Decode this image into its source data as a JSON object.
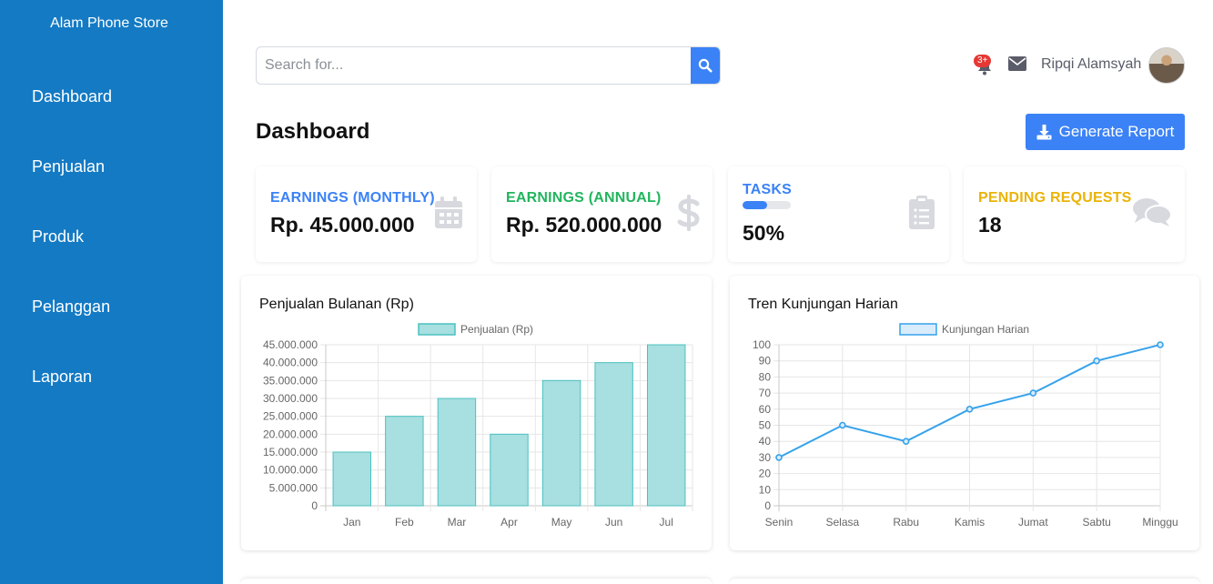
{
  "app": {
    "brand": "Alam Phone Store"
  },
  "sidebar": {
    "items": [
      {
        "label": "Dashboard"
      },
      {
        "label": "Penjualan"
      },
      {
        "label": "Produk"
      },
      {
        "label": "Pelanggan"
      },
      {
        "label": "Laporan"
      }
    ]
  },
  "topbar": {
    "search_placeholder": "Search for...",
    "search_icon": "search-icon",
    "alerts_badge": "3+",
    "user_name": "Ripqi Alamsyah"
  },
  "page": {
    "title": "Dashboard",
    "report_button": "Generate Report"
  },
  "cards": [
    {
      "label": "EARNINGS (MONTHLY)",
      "value": "Rp. 45.000.000",
      "color": "#3b82f6",
      "icon": "calendar-icon"
    },
    {
      "label": "EARNINGS (ANNUAL)",
      "value": "Rp. 520.000.000",
      "color": "#22b55e",
      "icon": "dollar-icon"
    },
    {
      "label": "TASKS",
      "value": "50%",
      "progress": 0.5,
      "color": "#3b82f6",
      "icon": "clipboard-icon"
    },
    {
      "label": "PENDING REQUESTS",
      "value": "18",
      "color": "#eab308",
      "icon": "comments-icon"
    }
  ],
  "colors": {
    "sidebar": "#147ac4",
    "primary": "#3b82f6",
    "bar_fill": "#a8dfe0",
    "bar_stroke": "#4bc0c0",
    "line": "#36a2eb"
  },
  "chart_data": [
    {
      "type": "bar",
      "title": "Penjualan Bulanan (Rp)",
      "categories": [
        "Jan",
        "Feb",
        "Mar",
        "Apr",
        "May",
        "Jun",
        "Jul"
      ],
      "series": [
        {
          "name": "Penjualan (Rp)",
          "values": [
            15000000,
            25000000,
            30000000,
            20000000,
            35000000,
            40000000,
            45000000
          ]
        }
      ],
      "ylim": [
        0,
        45000000
      ],
      "yticks": [
        "45.000.000",
        "40.000.000",
        "35.000.000",
        "30.000.000",
        "25.000.000",
        "20.000.000",
        "15.000.000",
        "10.000.000",
        "5.000.000",
        "0"
      ],
      "grid": true,
      "legend": "top"
    },
    {
      "type": "line",
      "title": "Tren Kunjungan Harian",
      "categories": [
        "Senin",
        "Selasa",
        "Rabu",
        "Kamis",
        "Jumat",
        "Sabtu",
        "Minggu"
      ],
      "series": [
        {
          "name": "Kunjungan Harian",
          "values": [
            30,
            50,
            40,
            60,
            70,
            90,
            100
          ]
        }
      ],
      "ylim": [
        0,
        100
      ],
      "yticks": [
        "100",
        "90",
        "80",
        "70",
        "60",
        "50",
        "40",
        "30",
        "20",
        "10",
        "0"
      ],
      "grid": true,
      "legend": "top"
    }
  ]
}
